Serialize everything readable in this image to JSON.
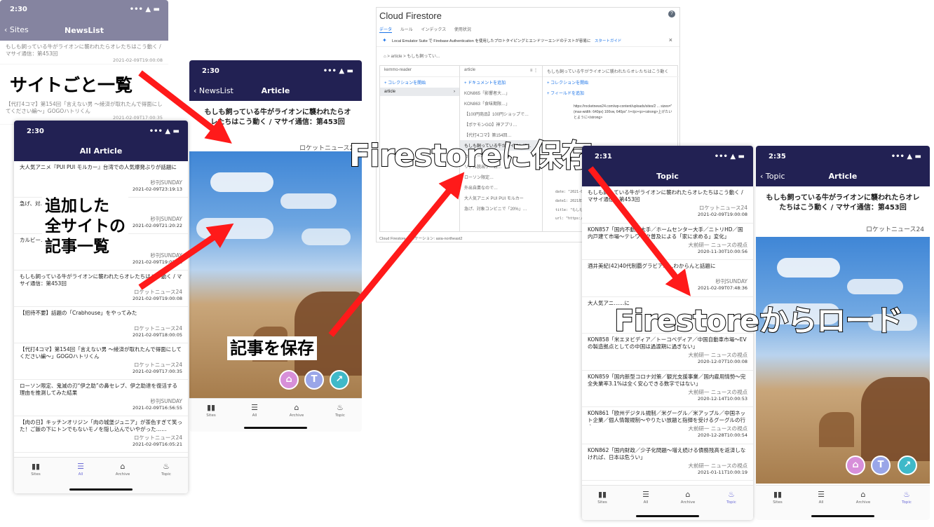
{
  "screen1": {
    "time": "2:30",
    "status_icons": "••• ▲ ▬",
    "back_label": "Sites",
    "title": "NewsList",
    "items": [
      {
        "title": "もしも飼っている牛がライオンに襲われたらオレたちはこう動く / マサイ通信：第453回",
        "date": "2021-02-09T19:00:08"
      },
      {
        "title": "【代打4コマ】第154回「言えない男 〜綾済が取れたんで得面にしてください編〜」GOGOハトリくん",
        "date": "2021-02-09T17:00:35"
      }
    ]
  },
  "caption_sites": "サイトごと一覧",
  "screen2": {
    "time": "2:30",
    "title": "All Article",
    "items": [
      {
        "title": "大人気アニメ『PUI PUI モルカー』台湾での人気爆発ぶりが話題に",
        "source": "秒刊SUNDAY",
        "date": "2021-02-09T23:19:13"
      },
      {
        "title": "急げ、対……任だけ実質半額、1本……中",
        "source": "秒刊SUNDAY",
        "date": "2021-02-09T21:20:22"
      },
      {
        "title": "カルビー……倍ウマくアレンジして……",
        "source": "秒刊SUNDAY",
        "date": "2021-02-09T19:02:48"
      },
      {
        "title": "もしも飼っている牛がライオンに襲われたらオレたちはこう動く / マサイ通信：第453回",
        "source": "ロケットニュース24",
        "date": "2021-02-09T19:00:08"
      },
      {
        "title": "【招待不要】話題の「Crabhouse」をやってみた",
        "source": "ロケットニュース24",
        "date": "2021-02-09T18:00:05"
      },
      {
        "title": "【代打4コマ】第154回「言えない男 〜綾済が取れたんで得面にしてください編〜」GOGOハトリくん",
        "source": "ロケットニュース24",
        "date": "2021-02-09T17:00:35"
      },
      {
        "title": "ローソン限定、鬼滅の刃“伊之助”の鼻セレブ、伊之助達を復活する理由を推測してみた結果",
        "source": "秒刊SUNDAY",
        "date": "2021-02-09T16:56:55"
      },
      {
        "title": "【肉の日】キッチンオリジン「肉の城堡ジュニア」が茶色すぎて笑った！ご飯の下にトンでもないモノを隠し込んでいやがった……",
        "source": "ロケットニュース24",
        "date": "2021-02-09T16:05:21"
      }
    ]
  },
  "caption_all": [
    "追加した",
    "全サイトの",
    "記事一覧"
  ],
  "tabs": {
    "sites": "Sites",
    "all": "All",
    "archive": "Archive",
    "topic": "Topic"
  },
  "screen3": {
    "time": "2:30",
    "back_label": "NewsList",
    "title": "Article",
    "article_title": "もしも飼っている牛がライオンに襲われたらオレたちはこう動く / マサイ通信：第453回",
    "source": "ロケットニュース24"
  },
  "caption_save": "記事を保存",
  "firestore": {
    "title": "Cloud Firestore",
    "tabs": [
      "データ",
      "ルール",
      "インデックス",
      "使用状況"
    ],
    "banner": "Local Emulator Suite で Firebase Authentication を使用したプロトタイピングとエンドツーエンドのテストが容易に",
    "banner_link": "スタートガイド",
    "breadcrumb": "⌂  >  article  >  もしも飼ってい...",
    "col1_header": "kemmo-reader",
    "col1_add": "コレクションを開始",
    "col1_item": "article",
    "col2_header": "article",
    "col2_add": "ドキュメントを追加",
    "col2_items": [
      "KON865「影響者大…」",
      "KON863「食味期限…」",
      "【100円商品】100円ショップで…",
      "【ポケモンGO】神アプリ…",
      "【代打4コマ】第154回…",
      "もしも飼っている牛がライオンに…",
      "カルビーの…",
      "リアル脱出ゲーム…",
      "ローソン限定…",
      "外出自粛なので…",
      "大人気アニメ PUI PUI モルカー",
      "急げ、対象コンビニで「20%」…"
    ],
    "col3_header": "もしも飼っている牛がライオンに襲われたらオレたちはこう動く",
    "col3_add1": "コレクションを開始",
    "col3_add2": "フィールドを追加",
    "col3_body": "https://rocketnews24.com/wp-content/uploads/sites/2 ... sizes=\"(max-width: 640px) 100vw, 640px\" /></p><p><strong>上げたいとように</strong>",
    "fields": [
      "date: \"2021-02-09T19:00:08\"",
      "date1: 2021年2月9日",
      "title: \"もしも飼っている…はこう…\"",
      "url: \"https://rocketnews24.com/…\""
    ],
    "footer": "Cloud Firestore のロケーション: asia-northeast2"
  },
  "caption_firestore_save": "Firestoreに保存",
  "screen4": {
    "time": "2:31",
    "title": "Topic",
    "items": [
      {
        "title": "もしも飼っている牛がライオンに襲われたらオレたちはこう動く / マサイ通信：第453回",
        "source": "ロケットニュース24",
        "date": "2021-02-09T19:00:08"
      },
      {
        "title": "KON857「国内不動産大手／ホームセンター大手／ニトリHD／国内戸建て市場〜テレワーク普及による「家に求める」変化」",
        "source": "大前研一 ニュースの視点",
        "date": "2020-11-30T10:00:56"
      },
      {
        "title": "酒井美紀(42)40代制覇グラビア……わからんと話題に",
        "source": "秒刊SUNDAY",
        "date": "2021-02-09T07:48:36"
      },
      {
        "title": "大人気アニ……に",
        "source": "",
        "date": ""
      },
      {
        "title": "KON858「米エヌビディア／トーコベディア／中国自動車市場〜EVの製造拠点としての中国は過渡期に過ぎない」",
        "source": "大前研一 ニュースの視点",
        "date": "2020-12-07T10:00:08"
      },
      {
        "title": "KON859「国内新型コロナ対策／観光支援事業／国内雇用情勢〜完全失業率3.1%は全く安心できる数字ではない」",
        "source": "大前研一 ニュースの視点",
        "date": "2020-12-14T10:00:53"
      },
      {
        "title": "KON861「欧州デジタル規制／米グーグル／米アップル／中国ネット企業／個人情報規制〜やりたい放題と指弾を受けるグーグルの行方」",
        "source": "大前研一 ニュースの視点",
        "date": "2020-12-28T10:00:54"
      },
      {
        "title": "KON862「国内財政／少子化問題〜増え続ける債務残高を返済しなければ、日本は危うい」",
        "source": "大前研一 ニュースの視点",
        "date": "2021-01-11T10:00:19"
      }
    ]
  },
  "caption_firestore_load": "Firestoreからロード",
  "screen5": {
    "time": "2:35",
    "back_label": "Topic",
    "title": "Article",
    "article_title": "もしも飼っている牛がライオンに襲われたらオレたちはこう動く / マサイ通信：第453回",
    "source": "ロケットニュース24"
  },
  "buttons": {
    "archive": "⌂",
    "text": "T",
    "share": "↗"
  },
  "colors": {
    "nav": "#222153",
    "arrow": "#ff1a1a",
    "btn_pink": "#d78fd9",
    "btn_blue": "#9aa6e8",
    "btn_teal": "#3fb9c9"
  }
}
